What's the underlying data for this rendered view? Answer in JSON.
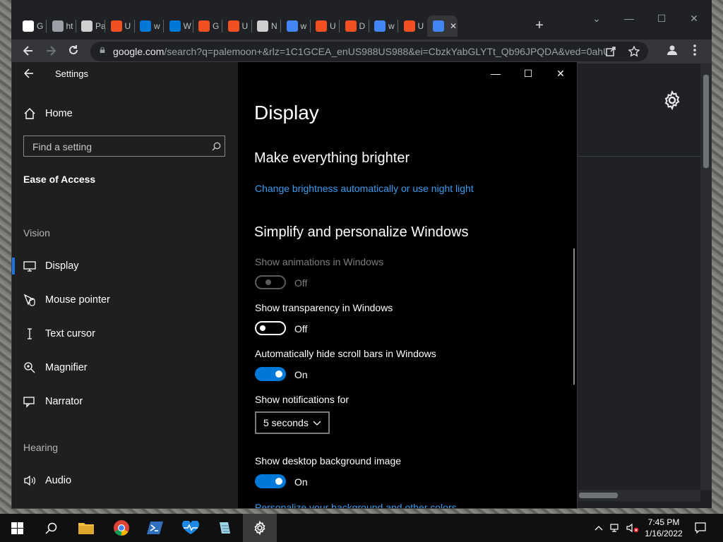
{
  "browser": {
    "tabs": [
      {
        "label": "G",
        "color": "#ffffff"
      },
      {
        "label": "ht",
        "color": "#9aa0a6"
      },
      {
        "label": "Pa",
        "color": "#cfcfcf"
      },
      {
        "label": "U",
        "color": "#f25022"
      },
      {
        "label": "w",
        "color": "#0078d7"
      },
      {
        "label": "W",
        "color": "#0078d7"
      },
      {
        "label": "G",
        "color": "#f25022"
      },
      {
        "label": "U",
        "color": "#f25022"
      },
      {
        "label": "N",
        "color": "#cfcfcf"
      },
      {
        "label": "w",
        "color": "#4285f4"
      },
      {
        "label": "U",
        "color": "#f25022"
      },
      {
        "label": "D",
        "color": "#f25022"
      },
      {
        "label": "w",
        "color": "#4285f4"
      },
      {
        "label": "U",
        "color": "#f25022"
      },
      {
        "label": "",
        "color": "#4285f4",
        "active": true
      }
    ],
    "close_tab_glyph": "✕",
    "new_tab_glyph": "+",
    "url_host": "google.com",
    "url_rest": "/search?q=palemoon+&rlz=1C1GCEA_enUS988US988&ei=CbzkYabGLYTt_Qb96JPQDA&ved=0ahU..."
  },
  "settings": {
    "window_title": "Settings",
    "home_label": "Home",
    "search_placeholder": "Find a setting",
    "category": "Ease of Access",
    "vision_label": "Vision",
    "nav": [
      {
        "label": "Display",
        "icon": "monitor-icon",
        "selected": true
      },
      {
        "label": "Mouse pointer",
        "icon": "mouse-pointer-icon"
      },
      {
        "label": "Text cursor",
        "icon": "text-cursor-icon"
      },
      {
        "label": "Magnifier",
        "icon": "magnifier-icon"
      },
      {
        "label": "Narrator",
        "icon": "narrator-icon"
      }
    ],
    "hearing_label": "Hearing",
    "audio_label": "Audio",
    "page_title": "Display",
    "section1_title": "Make everything brighter",
    "brightness_link": "Change brightness automatically or use night light",
    "section2_title": "Simplify and personalize Windows",
    "options": [
      {
        "label": "Show animations in Windows",
        "state": "Off",
        "disabled": true
      },
      {
        "label": "Show transparency in Windows",
        "state": "Off"
      },
      {
        "label": "Automatically hide scroll bars in Windows",
        "state": "On"
      }
    ],
    "notifications_label": "Show notifications for",
    "notifications_value": "5 seconds",
    "background_label": "Show desktop background image",
    "background_state": "On",
    "background_link": "Personalize your background and other colors"
  },
  "taskbar": {
    "time": "7:45 PM",
    "date": "1/16/2022"
  },
  "colors": {
    "accent": "#0078d7",
    "link": "#3b9cf0"
  }
}
